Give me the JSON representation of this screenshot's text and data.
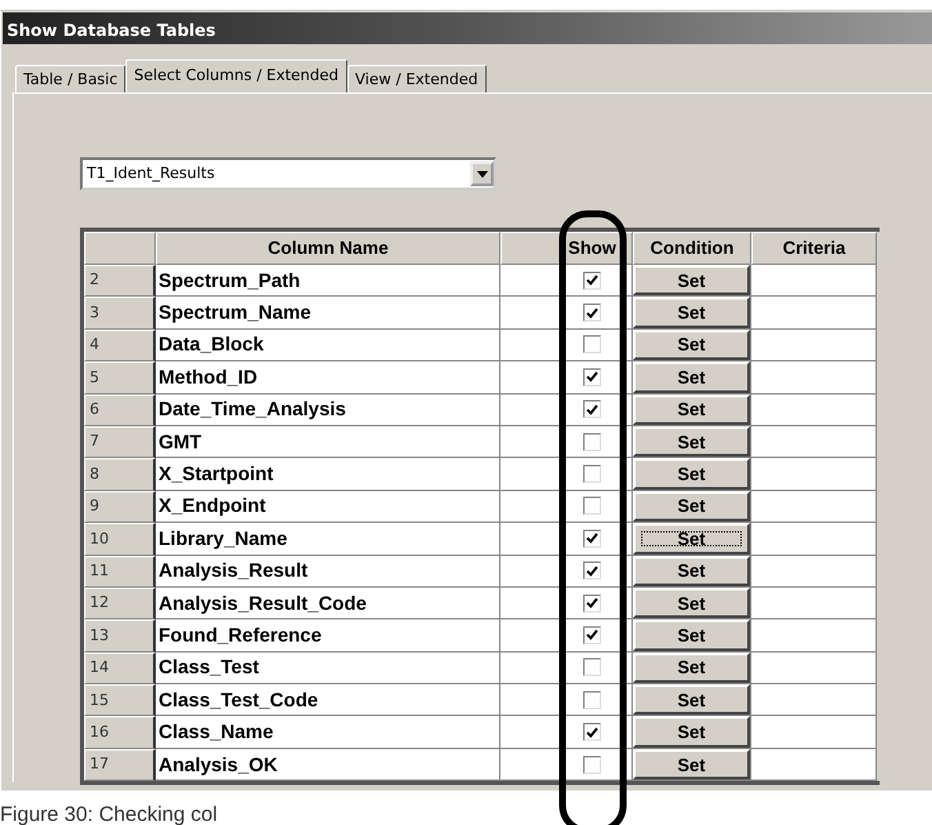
{
  "window": {
    "title": "Show Database Tables"
  },
  "tabs": [
    {
      "label": "Table / Basic",
      "selected": false
    },
    {
      "label": "Select Columns / Extended",
      "selected": true
    },
    {
      "label": "View / Extended",
      "selected": false
    }
  ],
  "table_select": {
    "value": "T1_Ident_Results"
  },
  "table": {
    "columns": [
      "Column Name",
      "Show",
      "Condition",
      "Criteria"
    ],
    "rows": [
      {
        "number": "2",
        "name": "Spectrum_Path",
        "show": true,
        "button": "Set",
        "focused": false
      },
      {
        "number": "3",
        "name": "Spectrum_Name",
        "show": true,
        "button": "Set",
        "focused": false
      },
      {
        "number": "4",
        "name": "Data_Block",
        "show": false,
        "button": "Set",
        "focused": false
      },
      {
        "number": "5",
        "name": "Method_ID",
        "show": true,
        "button": "Set",
        "focused": false
      },
      {
        "number": "6",
        "name": "Date_Time_Analysis",
        "show": true,
        "button": "Set",
        "focused": false
      },
      {
        "number": "7",
        "name": "GMT",
        "show": false,
        "button": "Set",
        "focused": false
      },
      {
        "number": "8",
        "name": "X_Startpoint",
        "show": false,
        "button": "Set",
        "focused": false
      },
      {
        "number": "9",
        "name": "X_Endpoint",
        "show": false,
        "button": "Set",
        "focused": false
      },
      {
        "number": "10",
        "name": "Library_Name",
        "show": true,
        "button": "Set",
        "focused": true
      },
      {
        "number": "11",
        "name": "Analysis_Result",
        "show": true,
        "button": "Set",
        "focused": false
      },
      {
        "number": "12",
        "name": "Analysis_Result_Code",
        "show": true,
        "button": "Set",
        "focused": false
      },
      {
        "number": "13",
        "name": "Found_Reference",
        "show": true,
        "button": "Set",
        "focused": false
      },
      {
        "number": "14",
        "name": "Class_Test",
        "show": false,
        "button": "Set",
        "focused": false
      },
      {
        "number": "15",
        "name": "Class_Test_Code",
        "show": false,
        "button": "Set",
        "focused": false
      },
      {
        "number": "16",
        "name": "Class_Name",
        "show": true,
        "button": "Set",
        "focused": false
      },
      {
        "number": "17",
        "name": "Analysis_OK",
        "show": false,
        "button": "Set",
        "focused": false
      }
    ]
  },
  "caption": "Figure 30:  Checking col"
}
